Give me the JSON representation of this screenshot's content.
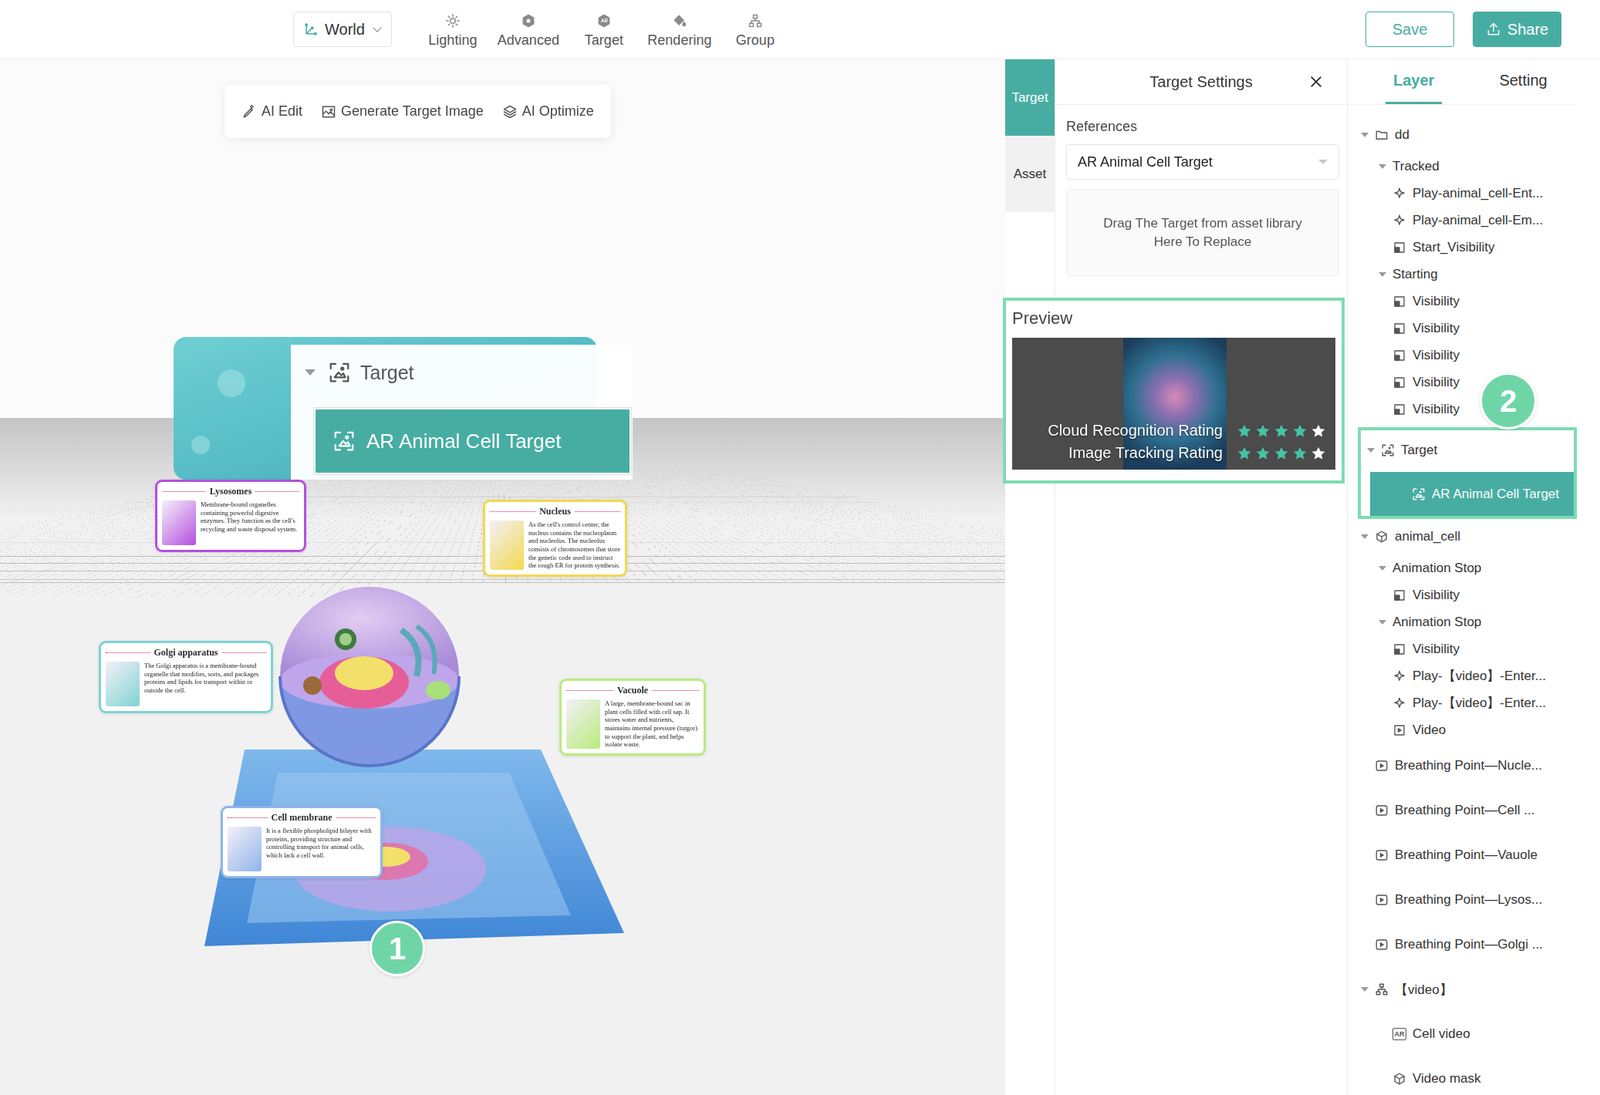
{
  "topbar": {
    "world": "World",
    "tools": [
      {
        "label": "Lighting",
        "kind": "lighting"
      },
      {
        "label": "Advanced",
        "kind": "advanced"
      },
      {
        "label": "Target",
        "kind": "target"
      },
      {
        "label": "Rendering",
        "kind": "rendering"
      },
      {
        "label": "Group",
        "kind": "group"
      }
    ],
    "save": "Save",
    "share": "Share"
  },
  "viewport": {
    "toolbar": [
      {
        "label": "AI Edit",
        "kind": "edit"
      },
      {
        "label": "Generate Target Image",
        "kind": "image"
      },
      {
        "label": "AI Optimize",
        "kind": "layers"
      }
    ],
    "callout": {
      "parent": "Target",
      "parent_expanded": true,
      "child": "AR Animal Cell Target",
      "child_selected": true
    },
    "cards": [
      {
        "title": "Lysosomes",
        "body": "Membrane-bound organelles containing powerful digestive enzymes. They function as the cell's recycling and waste disposal system.",
        "color": "#b44fe0"
      },
      {
        "title": "Nucleus",
        "body": "As the cell's control center, the nucleus contains the nucleoplasm and nucleolus. The nucleolus consists of chromosomes that store the genetic code used to instruct the rough ER for protein synthesis.",
        "color": "#f2d94e"
      },
      {
        "title": "Golgi apparatus",
        "body": "The Golgi apparatus is a membrane-bound organelle that modifies, sorts, and packages proteins and lipids for transport within or outside the cell.",
        "color": "#7fd3d3"
      },
      {
        "title": "Vacuole",
        "body": "A large, membrane-bound sac in plant cells filled with cell sap. It stores water and nutrients, maintains internal pressure (turgor) to support the plant, and helps isolate waste.",
        "color": "#b8ec7a"
      },
      {
        "title": "Cell membrane",
        "body": "It is a flexible phospholipid bilayer with proteins, providing structure and controlling transport for animal cells, which lack a cell wall.",
        "color": "#8fb4ea"
      }
    ],
    "badge": "1"
  },
  "side_tabs": [
    {
      "label": "Target",
      "selected": true
    },
    {
      "label": "Asset",
      "selected": false
    }
  ],
  "target_settings": {
    "title": "Target Settings",
    "references_label": "References",
    "reference": "AR Animal Cell Target",
    "drop_hint": [
      "Drag The Target from asset library",
      "Here To Replace"
    ],
    "preview": {
      "label": "Preview",
      "highlighted": true,
      "ratings": [
        {
          "label": "Cloud Recognition Rating",
          "stars": 4,
          "max_stars": 5
        },
        {
          "label": "Image Tracking Rating",
          "stars": 4,
          "max_stars": 5
        }
      ]
    }
  },
  "layer_panel": {
    "tabs": [
      {
        "label": "Layer",
        "selected": true
      },
      {
        "label": "Setting",
        "selected": false
      }
    ],
    "badge": "2",
    "items": [
      {
        "label": "dd",
        "level": 0,
        "kind": "folder",
        "expanded": true,
        "selected": false,
        "highlighted": false
      },
      {
        "label": "Tracked",
        "level": 1,
        "kind": "label",
        "expanded": true,
        "selected": false,
        "highlighted": false
      },
      {
        "label": "Play-animal_cell-Ent...",
        "level": 2,
        "kind": "action",
        "expanded": false,
        "selected": false,
        "highlighted": false
      },
      {
        "label": "Play-animal_cell-Em...",
        "level": 2,
        "kind": "action",
        "expanded": false,
        "selected": false,
        "highlighted": false
      },
      {
        "label": "Start_Visibility",
        "level": 2,
        "kind": "visibility",
        "expanded": false,
        "selected": false,
        "highlighted": false
      },
      {
        "label": "Starting",
        "level": 1,
        "kind": "label",
        "expanded": true,
        "selected": false,
        "highlighted": false
      },
      {
        "label": "Visibility",
        "level": 2,
        "kind": "visibility",
        "expanded": false,
        "selected": false,
        "highlighted": false
      },
      {
        "label": "Visibility",
        "level": 2,
        "kind": "visibility",
        "expanded": false,
        "selected": false,
        "highlighted": false
      },
      {
        "label": "Visibility",
        "level": 2,
        "kind": "visibility",
        "expanded": false,
        "selected": false,
        "highlighted": false
      },
      {
        "label": "Visibility",
        "level": 2,
        "kind": "visibility",
        "expanded": false,
        "selected": false,
        "highlighted": false
      },
      {
        "label": "Visibility",
        "level": 2,
        "kind": "visibility",
        "expanded": false,
        "selected": false,
        "highlighted": false
      },
      {
        "label": "Target",
        "level": 0,
        "kind": "target",
        "expanded": true,
        "selected": false,
        "highlighted": true
      },
      {
        "label": "AR Animal Cell Target",
        "level": 1,
        "kind": "image",
        "expanded": false,
        "selected": true,
        "highlighted": true
      },
      {
        "label": "animal_cell",
        "level": 0,
        "kind": "model",
        "expanded": true,
        "selected": false,
        "highlighted": false
      },
      {
        "label": "Animation Stop",
        "level": 1,
        "kind": "label",
        "expanded": true,
        "selected": false,
        "highlighted": false
      },
      {
        "label": "Visibility",
        "level": 2,
        "kind": "visibility",
        "expanded": false,
        "selected": false,
        "highlighted": false
      },
      {
        "label": "Animation Stop",
        "level": 1,
        "kind": "label",
        "expanded": true,
        "selected": false,
        "highlighted": false
      },
      {
        "label": "Visibility",
        "level": 2,
        "kind": "visibility",
        "expanded": false,
        "selected": false,
        "highlighted": false
      },
      {
        "label": "Play-【video】-Enter...",
        "level": 2,
        "kind": "action",
        "expanded": false,
        "selected": false,
        "highlighted": false
      },
      {
        "label": "Play-【video】-Enter...",
        "level": 2,
        "kind": "action",
        "expanded": false,
        "selected": false,
        "highlighted": false
      },
      {
        "label": "Video",
        "level": 2,
        "kind": "video",
        "expanded": false,
        "selected": false,
        "highlighted": false
      },
      {
        "label": "Breathing Point—Nucle...",
        "level": 0,
        "kind": "media",
        "expanded": false,
        "selected": false,
        "highlighted": false
      },
      {
        "label": "Breathing Point—Cell ...",
        "level": 0,
        "kind": "media",
        "expanded": false,
        "selected": false,
        "highlighted": false
      },
      {
        "label": "Breathing Point—Vauole",
        "level": 0,
        "kind": "media",
        "expanded": false,
        "selected": false,
        "highlighted": false
      },
      {
        "label": "Breathing Point—Lysos...",
        "level": 0,
        "kind": "media",
        "expanded": false,
        "selected": false,
        "highlighted": false
      },
      {
        "label": "Breathing Point—Golgi ...",
        "level": 0,
        "kind": "media",
        "expanded": false,
        "selected": false,
        "highlighted": false
      },
      {
        "label": "【video】",
        "level": 0,
        "kind": "grouping",
        "expanded": true,
        "selected": false,
        "highlighted": false
      },
      {
        "label": "Cell video",
        "level": 1,
        "kind": "ar",
        "icon_text": "AR",
        "expanded": false,
        "selected": false,
        "highlighted": false
      },
      {
        "label": "Video mask",
        "level": 1,
        "kind": "mesh",
        "expanded": false,
        "selected": false,
        "highlighted": false
      }
    ]
  }
}
